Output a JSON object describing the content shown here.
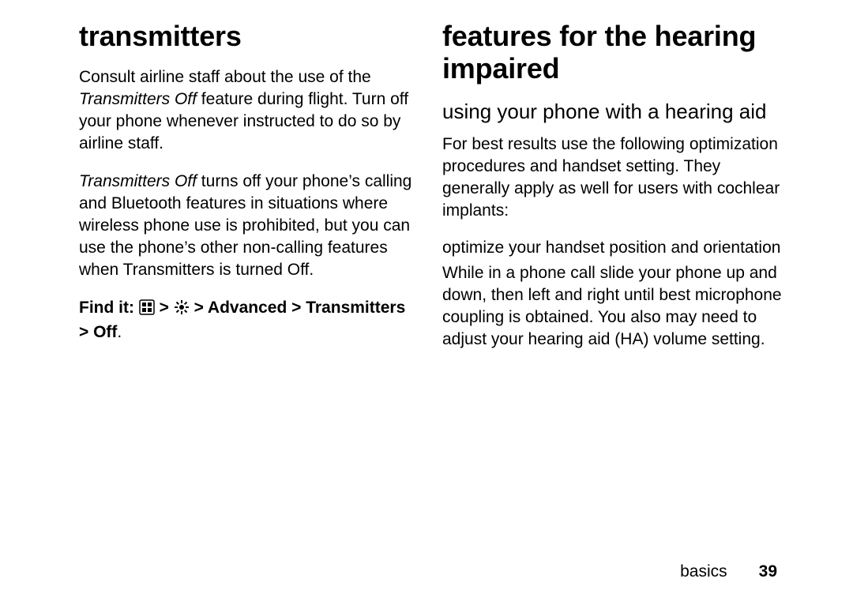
{
  "left": {
    "heading": "transmitters",
    "p1_a": "Consult airline staff about the use of the ",
    "p1_i": "Transmitters Off",
    "p1_b": " feature during flight. Turn off your phone whenever instructed to do so by airline staff.",
    "p2_i": "Transmitters Off",
    "p2_b": " turns off your phone’s calling and Bluetooth features in situations where wireless phone use is prohibited, but you can use the phone’s other non-calling features when Transmitters is turned Off.",
    "findit_label": "Find it: ",
    "findit_path": " > Advanced > Transmitters > Off",
    "findit_dot": "."
  },
  "right": {
    "heading": "features for the hearing impaired",
    "sub1": "using your phone with a hearing aid",
    "p1": "For best results use the following optimization procedures and handset setting. They generally apply as well for users with cochlear implants:",
    "sub2": "optimize your handset position and orientation",
    "p2": "While in a phone call slide your phone up and down, then left and right until best microphone coupling is obtained.   You also may need to adjust your hearing aid (HA) volume setting."
  },
  "footer": {
    "section": "basics",
    "page": "39"
  }
}
